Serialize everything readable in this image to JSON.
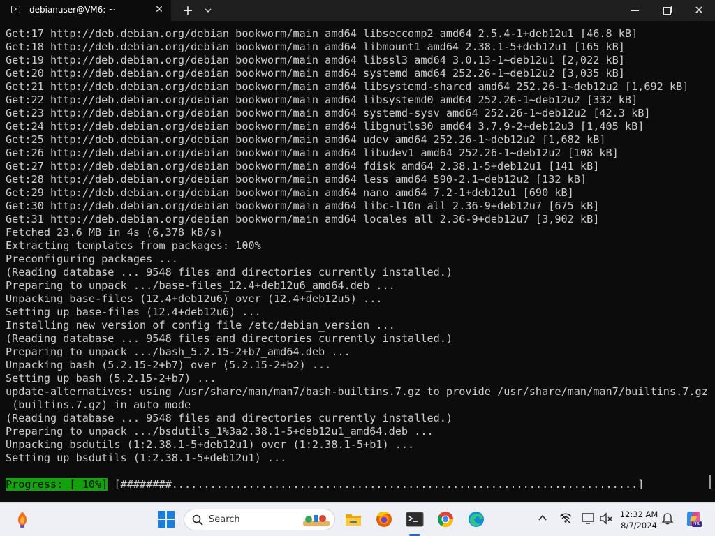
{
  "window": {
    "tab_title": "debianuser@VM6: ~",
    "tab_close_glyph": "✕",
    "new_tab_glyph": "+",
    "dropdown_glyph": "⌄",
    "close_glyph": "✕"
  },
  "terminal": {
    "lines": [
      "Get:17 http://deb.debian.org/debian bookworm/main amd64 libseccomp2 amd64 2.5.4-1+deb12u1 [46.8 kB]",
      "Get:18 http://deb.debian.org/debian bookworm/main amd64 libmount1 amd64 2.38.1-5+deb12u1 [165 kB]",
      "Get:19 http://deb.debian.org/debian bookworm/main amd64 libssl3 amd64 3.0.13-1~deb12u1 [2,022 kB]",
      "Get:20 http://deb.debian.org/debian bookworm/main amd64 systemd amd64 252.26-1~deb12u2 [3,035 kB]",
      "Get:21 http://deb.debian.org/debian bookworm/main amd64 libsystemd-shared amd64 252.26-1~deb12u2 [1,692 kB]",
      "Get:22 http://deb.debian.org/debian bookworm/main amd64 libsystemd0 amd64 252.26-1~deb12u2 [332 kB]",
      "Get:23 http://deb.debian.org/debian bookworm/main amd64 systemd-sysv amd64 252.26-1~deb12u2 [42.3 kB]",
      "Get:24 http://deb.debian.org/debian bookworm/main amd64 libgnutls30 amd64 3.7.9-2+deb12u3 [1,405 kB]",
      "Get:25 http://deb.debian.org/debian bookworm/main amd64 udev amd64 252.26-1~deb12u2 [1,682 kB]",
      "Get:26 http://deb.debian.org/debian bookworm/main amd64 libudev1 amd64 252.26-1~deb12u2 [108 kB]",
      "Get:27 http://deb.debian.org/debian bookworm/main amd64 fdisk amd64 2.38.1-5+deb12u1 [141 kB]",
      "Get:28 http://deb.debian.org/debian bookworm/main amd64 less amd64 590-2.1~deb12u2 [132 kB]",
      "Get:29 http://deb.debian.org/debian bookworm/main amd64 nano amd64 7.2-1+deb12u1 [690 kB]",
      "Get:30 http://deb.debian.org/debian bookworm/main amd64 libc-l10n all 2.36-9+deb12u7 [675 kB]",
      "Get:31 http://deb.debian.org/debian bookworm/main amd64 locales all 2.36-9+deb12u7 [3,902 kB]",
      "Fetched 23.6 MB in 4s (6,378 kB/s)",
      "Extracting templates from packages: 100%",
      "Preconfiguring packages ...",
      "(Reading database ... 9548 files and directories currently installed.)",
      "Preparing to unpack .../base-files_12.4+deb12u6_amd64.deb ...",
      "Unpacking base-files (12.4+deb12u6) over (12.4+deb12u5) ...",
      "Setting up base-files (12.4+deb12u6) ...",
      "Installing new version of config file /etc/debian_version ...",
      "(Reading database ... 9548 files and directories currently installed.)",
      "Preparing to unpack .../bash_5.2.15-2+b7_amd64.deb ...",
      "Unpacking bash (5.2.15-2+b7) over (5.2.15-2+b2) ...",
      "Setting up bash (5.2.15-2+b7) ...",
      "update-alternatives: using /usr/share/man/man7/bash-builtins.7.gz to provide /usr/share/man/man7/builtins.7.gz",
      " (builtins.7.gz) in auto mode",
      "(Reading database ... 9548 files and directories currently installed.)",
      "Preparing to unpack .../bsdutils_1%3a2.38.1-5+deb12u1_amd64.deb ...",
      "Unpacking bsdutils (1:2.38.1-5+deb12u1) over (1:2.38.1-5+b1) ...",
      "Setting up bsdutils (1:2.38.1-5+deb12u1) ..."
    ],
    "progress_label": "Progress: [ 10%]",
    "progress_bar": " [########.........................................................................]",
    "progress_fraction": 0.1
  },
  "taskbar": {
    "search_placeholder": "Search",
    "time": "12:32 AM",
    "date": "8/7/2024",
    "pinned_apps": [
      "start-icon",
      "file-explorer-icon",
      "firefox-icon",
      "terminal-icon",
      "chrome-icon",
      "edge-icon"
    ],
    "tray_icons": [
      "chevron-up-icon",
      "network-off-icon",
      "display-icon",
      "volume-muted-icon",
      "bell-icon",
      "copilot-icon"
    ],
    "copilot_badge": "PRE"
  },
  "colors": {
    "terminal_bg": "#0c0c0c",
    "terminal_fg": "#cccccc",
    "progress_green": "#13a10e",
    "titlebar_bg": "#1f1f1f",
    "taskbar_bg": "#eef0f5"
  }
}
